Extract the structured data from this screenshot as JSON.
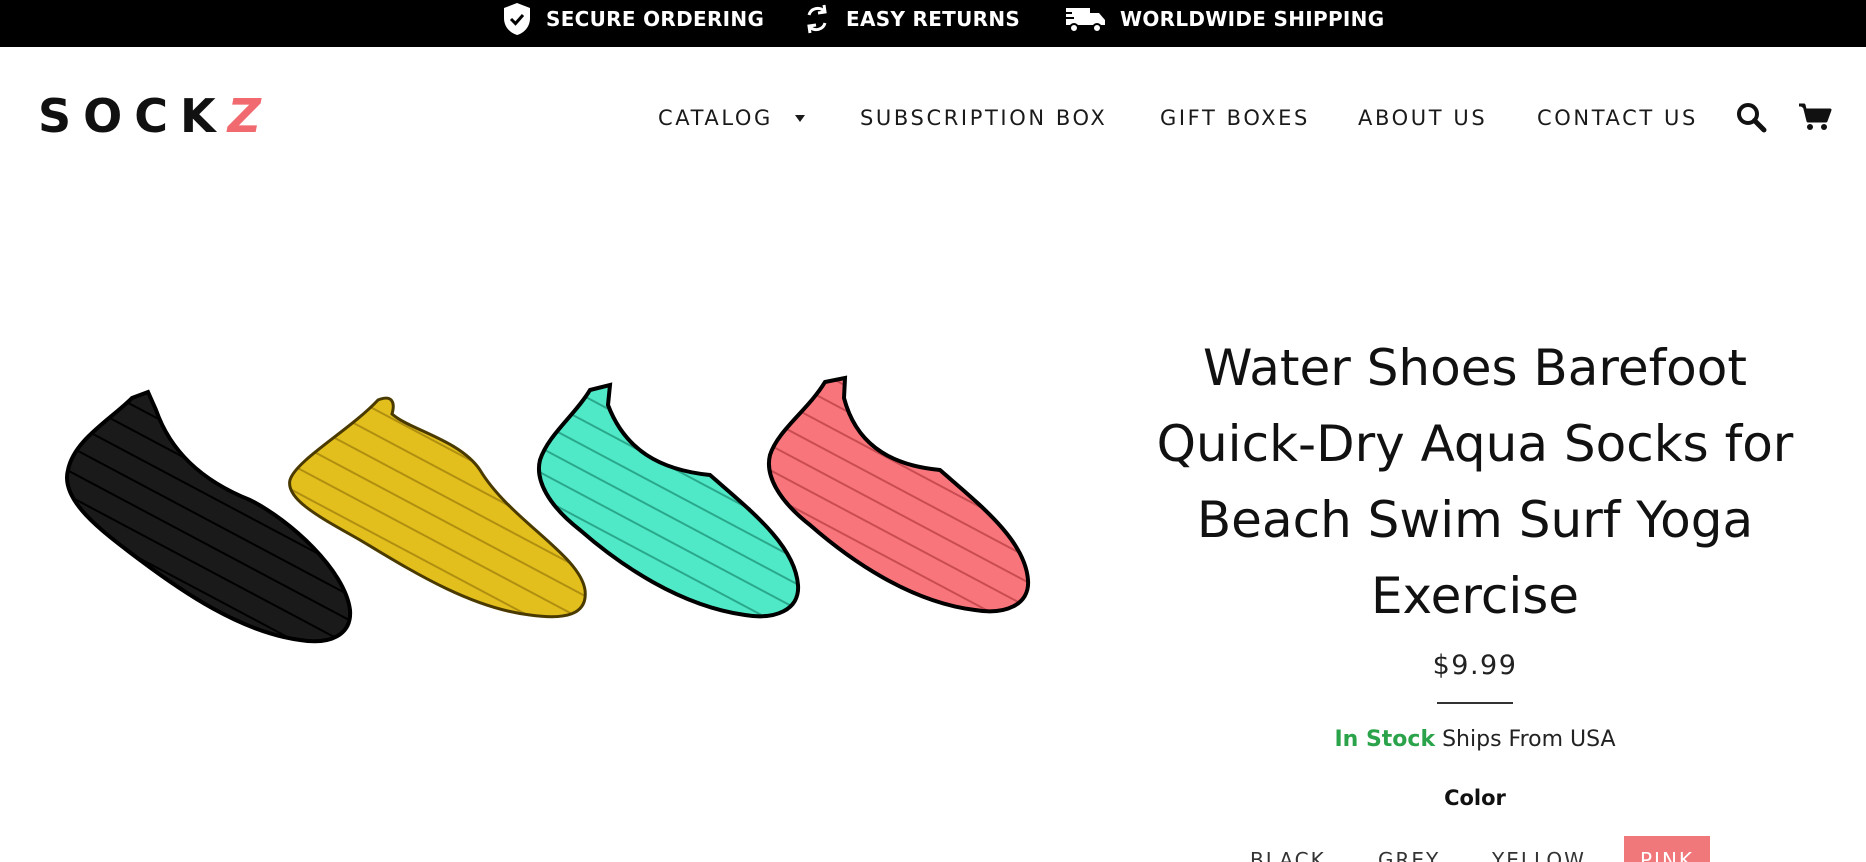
{
  "topbar": {
    "items": [
      {
        "icon": "shield-check-icon",
        "label": "SECURE ORDERING"
      },
      {
        "icon": "refresh-icon",
        "label": "EASY RETURNS"
      },
      {
        "icon": "truck-icon",
        "label": "WORLDWIDE SHIPPING"
      }
    ]
  },
  "header": {
    "logo": {
      "main": "SOCK",
      "accent": "Z"
    },
    "nav": [
      {
        "label": "CATALOG",
        "has_dropdown": true
      },
      {
        "label": "SUBSCRIPTION BOX"
      },
      {
        "label": "GIFT BOXES"
      },
      {
        "label": "ABOUT US"
      },
      {
        "label": "CONTACT US"
      }
    ],
    "icons": [
      "search-icon",
      "cart-icon"
    ]
  },
  "product": {
    "title": "Water Shoes Barefoot Quick-Dry Aqua Socks for Beach Swim Surf Yoga Exercise",
    "price": "$9.99",
    "stock_status": "In Stock",
    "ships_from": "Ships From USA",
    "color_label": "Color",
    "colors": [
      {
        "label": "BLACK",
        "selected": false
      },
      {
        "label": "GREY",
        "selected": false
      },
      {
        "label": "YELLOW",
        "selected": false
      },
      {
        "label": "PINK",
        "selected": true
      }
    ],
    "image_colors": [
      "#141414",
      "#e2bf1d",
      "#4fe9c7",
      "#f8757b"
    ]
  },
  "colors": {
    "topbar_bg": "#000000",
    "logo_accent": "#f06a70",
    "in_stock": "#2aa34a",
    "selected_swatch": "#f0777a"
  }
}
